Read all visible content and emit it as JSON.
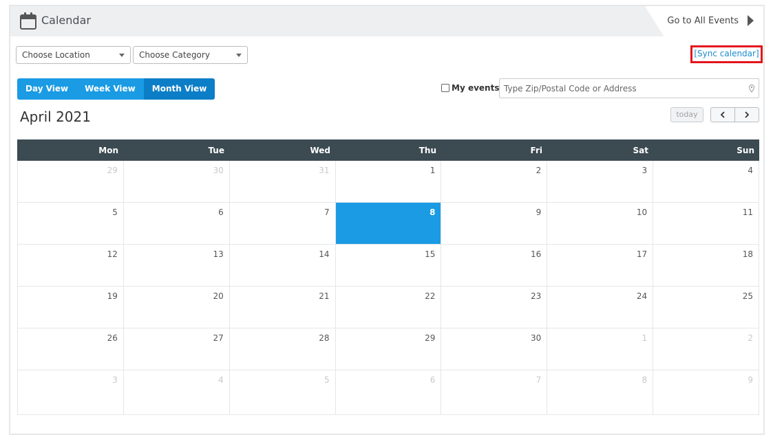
{
  "header": {
    "title": "Calendar",
    "goto_label": "Go to All Events"
  },
  "filters": {
    "location": "Choose Location",
    "category": "Choose Category"
  },
  "sync_label": "[Sync calendar]",
  "views": [
    "Day View",
    "Week View",
    "Month View"
  ],
  "active_view": "Month View",
  "my_events_label": "My events",
  "zip_placeholder": "Type Zip/Postal Code or Address",
  "month_title": "April 2021",
  "today_label": "today",
  "dow": [
    "Mon",
    "Tue",
    "Wed",
    "Thu",
    "Fri",
    "Sat",
    "Sun"
  ],
  "weeks": [
    [
      {
        "d": "29",
        "o": true
      },
      {
        "d": "30",
        "o": true
      },
      {
        "d": "31",
        "o": true
      },
      {
        "d": "1"
      },
      {
        "d": "2"
      },
      {
        "d": "3"
      },
      {
        "d": "4"
      }
    ],
    [
      {
        "d": "5"
      },
      {
        "d": "6"
      },
      {
        "d": "7"
      },
      {
        "d": "8",
        "t": true
      },
      {
        "d": "9"
      },
      {
        "d": "10"
      },
      {
        "d": "11"
      }
    ],
    [
      {
        "d": "12"
      },
      {
        "d": "13"
      },
      {
        "d": "14"
      },
      {
        "d": "15"
      },
      {
        "d": "16"
      },
      {
        "d": "17"
      },
      {
        "d": "18"
      }
    ],
    [
      {
        "d": "19"
      },
      {
        "d": "20"
      },
      {
        "d": "21"
      },
      {
        "d": "22"
      },
      {
        "d": "23"
      },
      {
        "d": "24"
      },
      {
        "d": "25"
      }
    ],
    [
      {
        "d": "26"
      },
      {
        "d": "27"
      },
      {
        "d": "28"
      },
      {
        "d": "29"
      },
      {
        "d": "30"
      },
      {
        "d": "1",
        "o": true
      },
      {
        "d": "2",
        "o": true
      }
    ],
    [
      {
        "d": "3",
        "o": true
      },
      {
        "d": "4",
        "o": true
      },
      {
        "d": "5",
        "o": true
      },
      {
        "d": "6",
        "o": true
      },
      {
        "d": "7",
        "o": true
      },
      {
        "d": "8",
        "o": true
      },
      {
        "d": "9",
        "o": true
      }
    ]
  ],
  "colors": {
    "accent": "#1a9be3",
    "accent_active": "#0c7ec7",
    "header_dark": "#3c4a52",
    "sync_border": "#e3141b"
  }
}
